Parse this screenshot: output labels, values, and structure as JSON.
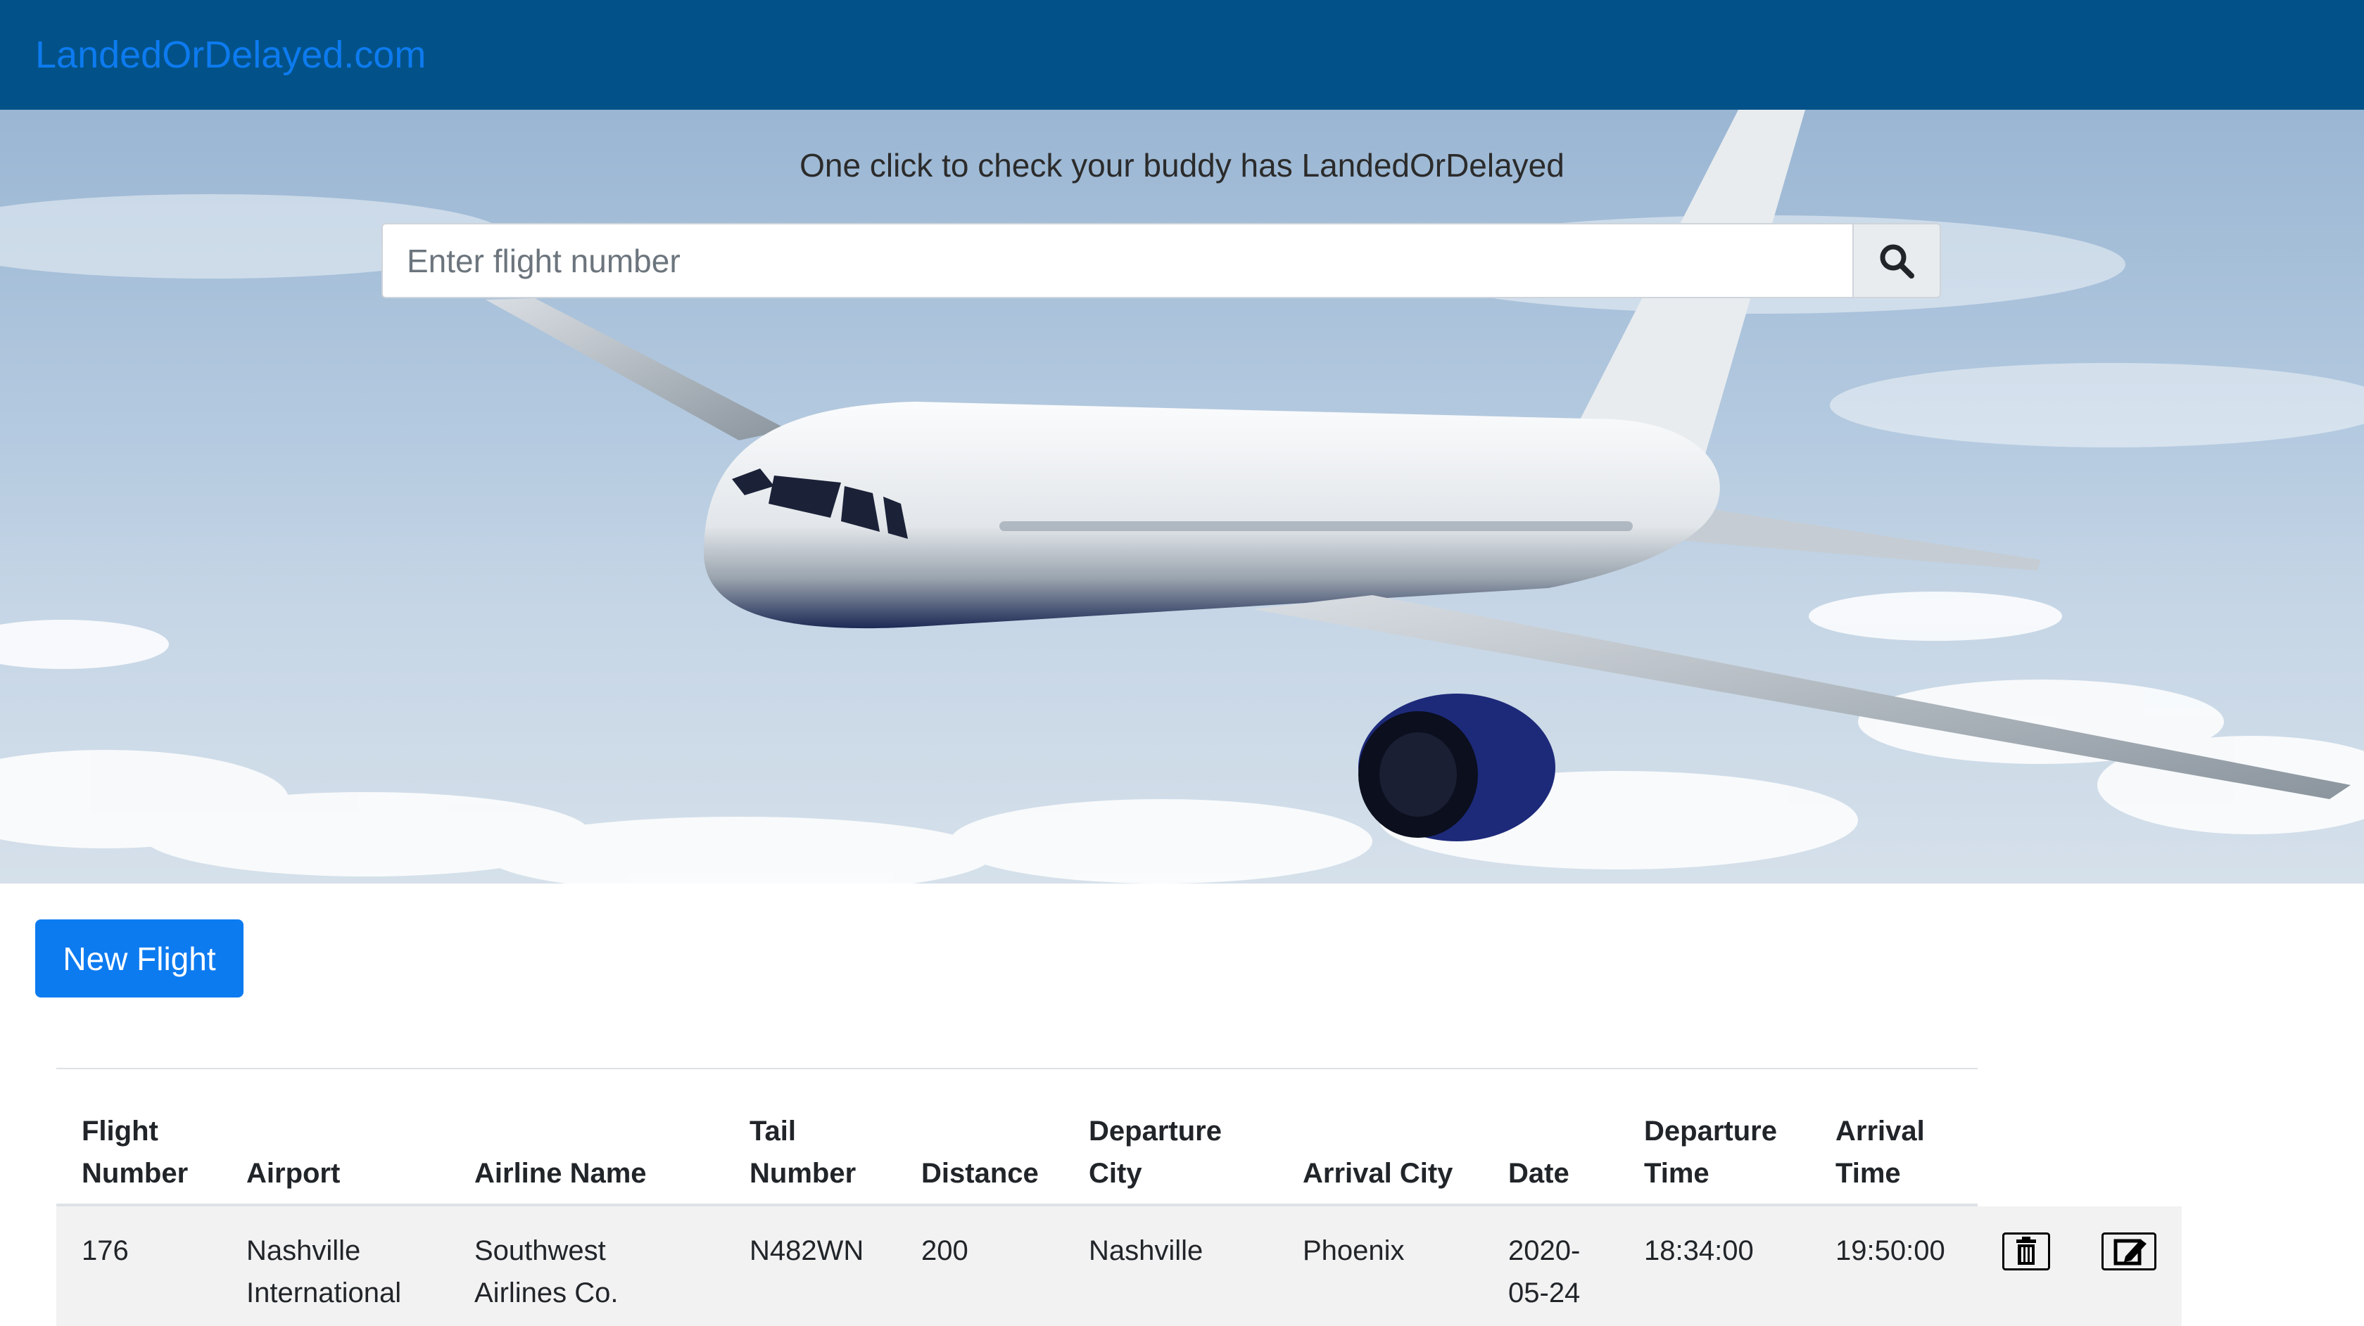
{
  "navbar": {
    "brand": "LandedOrDelayed.com"
  },
  "hero": {
    "tagline": "One click to check your buddy has LandedOrDelayed",
    "search": {
      "placeholder": "Enter flight number",
      "button_icon": "search-icon"
    }
  },
  "actions": {
    "new_flight_label": "New Flight"
  },
  "table": {
    "headers": [
      {
        "line1": "Flight",
        "line2": "Number"
      },
      {
        "line1": "",
        "line2": "Airport"
      },
      {
        "line1": "",
        "line2": "Airline Name"
      },
      {
        "line1": "Tail",
        "line2": "Number"
      },
      {
        "line1": "",
        "line2": "Distance"
      },
      {
        "line1": "Departure",
        "line2": "City"
      },
      {
        "line1": "",
        "line2": "Arrival City"
      },
      {
        "line1": "",
        "line2": "Date"
      },
      {
        "line1": "Departure",
        "line2": "Time"
      },
      {
        "line1": "Arrival",
        "line2": "Time"
      }
    ],
    "rows": [
      {
        "flight_number": "176",
        "airport_l1": "Nashville",
        "airport_l2": "International",
        "airline_l1": "Southwest",
        "airline_l2": "Airlines Co.",
        "tail_number": "N482WN",
        "distance": "200",
        "departure_city": "Nashville",
        "arrival_city": "Phoenix",
        "date_l1": "2020-",
        "date_l2": "05-24",
        "departure_time": "18:34:00",
        "arrival_time": "19:50:00",
        "delete_icon": "trash-icon",
        "edit_icon": "edit-icon"
      }
    ]
  },
  "colors": {
    "navbar": "#025289",
    "brand": "#0d7bf0",
    "primary_button": "#0d7bf0",
    "row_stripe": "#f2f2f2"
  }
}
